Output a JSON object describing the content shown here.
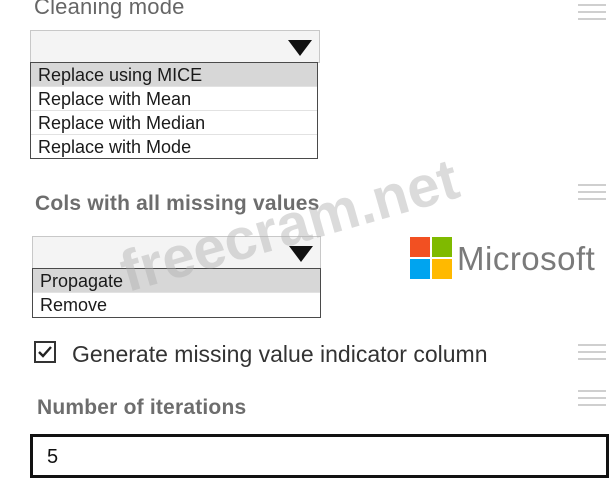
{
  "cleaning_mode": {
    "label": "Cleaning mode",
    "selected_value": "",
    "options": [
      {
        "label": "Replace using MICE",
        "selected": true
      },
      {
        "label": "Replace with Mean",
        "selected": false
      },
      {
        "label": "Replace with Median",
        "selected": false
      },
      {
        "label": "Replace with Mode",
        "selected": false
      }
    ]
  },
  "cols_missing": {
    "label": "Cols with all missing values",
    "selected_value": "",
    "options": [
      {
        "label": "Propagate",
        "selected": true
      },
      {
        "label": "Remove",
        "selected": false
      }
    ]
  },
  "indicator": {
    "label": "Generate missing value indicator column",
    "checked": true
  },
  "iterations": {
    "label": "Number of iterations",
    "value": "5"
  },
  "branding": {
    "logo_text": "Microsoft",
    "logo_colors": [
      "#f25022",
      "#7fba00",
      "#00a4ef",
      "#ffb900"
    ],
    "watermark": "freecram.net"
  }
}
